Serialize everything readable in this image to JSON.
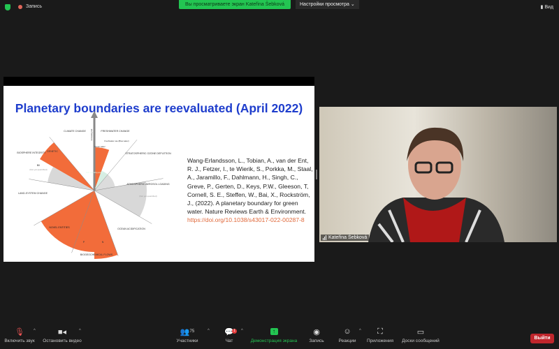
{
  "topbar": {
    "recording_label": "Запись",
    "sharing_banner": "Вы просматриваете экран Kateřina Šebková",
    "view_options": "Настройки просмотра",
    "view_label": "Вид"
  },
  "slide": {
    "title": "Planetary boundaries are reevaluated (April 2022)",
    "reference": "Wang-Erlandsson, L., Tobian, A., van der Ent, R. J., Fetzer, I., te Wierik, S., Porkka, M., Staal, A., Jaramillo, F., Dahlmann, H., Singh, C., Greve, P., Gerten, D., Keys, P.W., Gleeson, T, Cornell, S. E., Steffen, W., Bai, X., Rockström, J., (2022). A planetary boundary for green water. Nature Reviews Earth & Environment.",
    "reference_link": "https://doi.org/10.1038/s43017-022-00287-8",
    "diagram": {
      "climate": "CLIMATE CHANGE",
      "freshwater": "FRESHWATER CHANGE",
      "blue_water": "Freshwater use (Blue water)",
      "green_water": "Green water",
      "ozone": "STRATOSPHERIC OZONE DEPLETION",
      "aerosol": "ATMOSPHERIC AEROSOL LOADING",
      "not_quantified": "(Not yet quantified)",
      "ocean": "OCEAN ACIDIFICATION",
      "biogeo": "BIOGEOCHEMICAL FLOWS",
      "p": "P",
      "n": "N",
      "novel": "NOVEL ENTITIES",
      "land": "LAND-SYSTEM CHANGE",
      "bii": "BII",
      "genetic": "GENETIC",
      "biosphere": "BIOSPHERE INTEGRITY",
      "risk": "Increasing risk",
      "safe": "Safe operating space"
    }
  },
  "video": {
    "participant_name": "Kateřina Šebková"
  },
  "toolbar": {
    "unmute": "Включить звук",
    "stop_video": "Остановить видео",
    "participants": "Участники",
    "participants_count": "75",
    "chat": "Чат",
    "chat_badge": "1",
    "share": "Демонстрация экрана",
    "record": "Запись",
    "reactions": "Реакции",
    "apps": "Приложения",
    "whiteboards": "Доски сообщений",
    "leave": "Выйти"
  },
  "colors": {
    "accent_green": "#23c552",
    "leave_red": "#c0262c",
    "title_blue": "#1e3dcc",
    "link_orange": "#e06a3c"
  }
}
